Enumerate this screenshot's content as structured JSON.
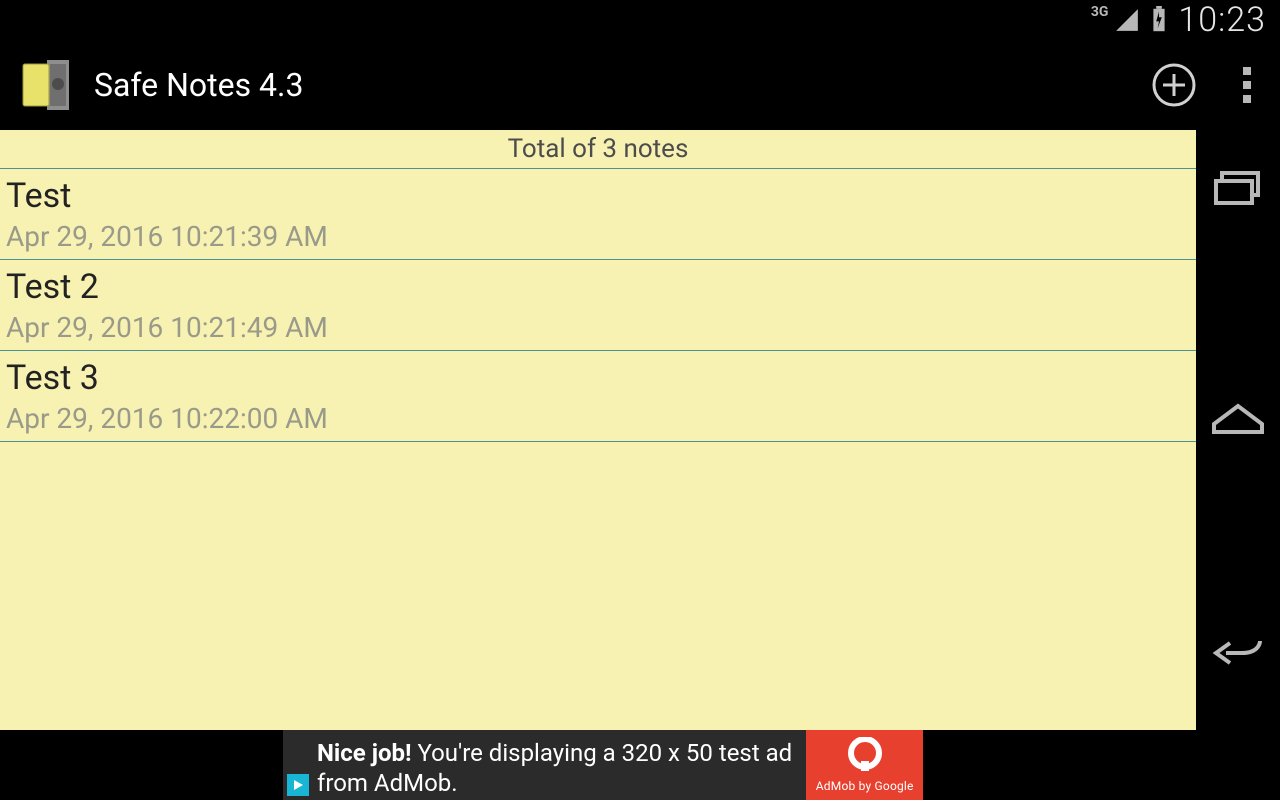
{
  "statusbar": {
    "network_label": "3G",
    "time": "10:23"
  },
  "appbar": {
    "title": "Safe Notes 4.3"
  },
  "content": {
    "header": "Total of 3 notes",
    "notes": [
      {
        "title": "Test",
        "timestamp": "Apr 29, 2016 10:21:39 AM"
      },
      {
        "title": "Test 2",
        "timestamp": "Apr 29, 2016 10:21:49 AM"
      },
      {
        "title": "Test 3",
        "timestamp": "Apr 29, 2016 10:22:00 AM"
      }
    ]
  },
  "ad": {
    "text_bold": "Nice job!",
    "text_rest": " You're displaying a 320 x 50 test ad from AdMob.",
    "brand": "AdMob by Google"
  }
}
